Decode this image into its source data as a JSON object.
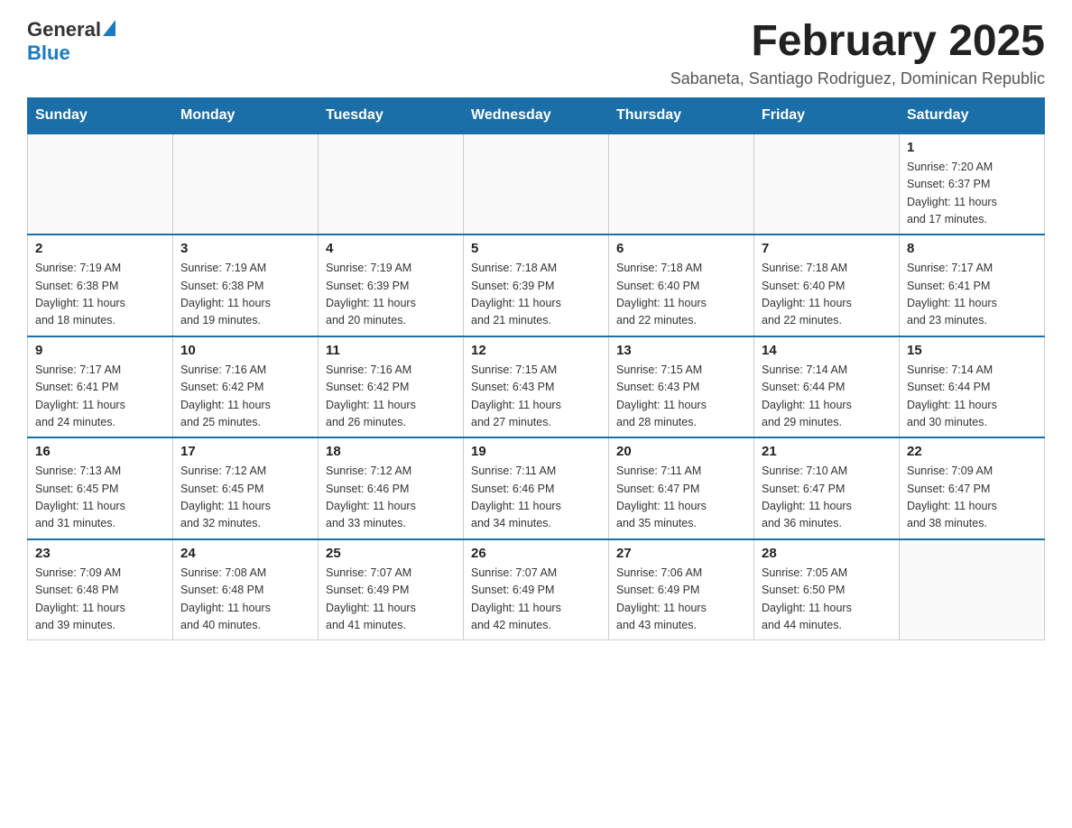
{
  "header": {
    "logo_general": "General",
    "logo_blue": "Blue",
    "main_title": "February 2025",
    "subtitle": "Sabaneta, Santiago Rodriguez, Dominican Republic"
  },
  "calendar": {
    "days_of_week": [
      "Sunday",
      "Monday",
      "Tuesday",
      "Wednesday",
      "Thursday",
      "Friday",
      "Saturday"
    ],
    "weeks": [
      [
        {
          "day": "",
          "info": ""
        },
        {
          "day": "",
          "info": ""
        },
        {
          "day": "",
          "info": ""
        },
        {
          "day": "",
          "info": ""
        },
        {
          "day": "",
          "info": ""
        },
        {
          "day": "",
          "info": ""
        },
        {
          "day": "1",
          "info": "Sunrise: 7:20 AM\nSunset: 6:37 PM\nDaylight: 11 hours\nand 17 minutes."
        }
      ],
      [
        {
          "day": "2",
          "info": "Sunrise: 7:19 AM\nSunset: 6:38 PM\nDaylight: 11 hours\nand 18 minutes."
        },
        {
          "day": "3",
          "info": "Sunrise: 7:19 AM\nSunset: 6:38 PM\nDaylight: 11 hours\nand 19 minutes."
        },
        {
          "day": "4",
          "info": "Sunrise: 7:19 AM\nSunset: 6:39 PM\nDaylight: 11 hours\nand 20 minutes."
        },
        {
          "day": "5",
          "info": "Sunrise: 7:18 AM\nSunset: 6:39 PM\nDaylight: 11 hours\nand 21 minutes."
        },
        {
          "day": "6",
          "info": "Sunrise: 7:18 AM\nSunset: 6:40 PM\nDaylight: 11 hours\nand 22 minutes."
        },
        {
          "day": "7",
          "info": "Sunrise: 7:18 AM\nSunset: 6:40 PM\nDaylight: 11 hours\nand 22 minutes."
        },
        {
          "day": "8",
          "info": "Sunrise: 7:17 AM\nSunset: 6:41 PM\nDaylight: 11 hours\nand 23 minutes."
        }
      ],
      [
        {
          "day": "9",
          "info": "Sunrise: 7:17 AM\nSunset: 6:41 PM\nDaylight: 11 hours\nand 24 minutes."
        },
        {
          "day": "10",
          "info": "Sunrise: 7:16 AM\nSunset: 6:42 PM\nDaylight: 11 hours\nand 25 minutes."
        },
        {
          "day": "11",
          "info": "Sunrise: 7:16 AM\nSunset: 6:42 PM\nDaylight: 11 hours\nand 26 minutes."
        },
        {
          "day": "12",
          "info": "Sunrise: 7:15 AM\nSunset: 6:43 PM\nDaylight: 11 hours\nand 27 minutes."
        },
        {
          "day": "13",
          "info": "Sunrise: 7:15 AM\nSunset: 6:43 PM\nDaylight: 11 hours\nand 28 minutes."
        },
        {
          "day": "14",
          "info": "Sunrise: 7:14 AM\nSunset: 6:44 PM\nDaylight: 11 hours\nand 29 minutes."
        },
        {
          "day": "15",
          "info": "Sunrise: 7:14 AM\nSunset: 6:44 PM\nDaylight: 11 hours\nand 30 minutes."
        }
      ],
      [
        {
          "day": "16",
          "info": "Sunrise: 7:13 AM\nSunset: 6:45 PM\nDaylight: 11 hours\nand 31 minutes."
        },
        {
          "day": "17",
          "info": "Sunrise: 7:12 AM\nSunset: 6:45 PM\nDaylight: 11 hours\nand 32 minutes."
        },
        {
          "day": "18",
          "info": "Sunrise: 7:12 AM\nSunset: 6:46 PM\nDaylight: 11 hours\nand 33 minutes."
        },
        {
          "day": "19",
          "info": "Sunrise: 7:11 AM\nSunset: 6:46 PM\nDaylight: 11 hours\nand 34 minutes."
        },
        {
          "day": "20",
          "info": "Sunrise: 7:11 AM\nSunset: 6:47 PM\nDaylight: 11 hours\nand 35 minutes."
        },
        {
          "day": "21",
          "info": "Sunrise: 7:10 AM\nSunset: 6:47 PM\nDaylight: 11 hours\nand 36 minutes."
        },
        {
          "day": "22",
          "info": "Sunrise: 7:09 AM\nSunset: 6:47 PM\nDaylight: 11 hours\nand 38 minutes."
        }
      ],
      [
        {
          "day": "23",
          "info": "Sunrise: 7:09 AM\nSunset: 6:48 PM\nDaylight: 11 hours\nand 39 minutes."
        },
        {
          "day": "24",
          "info": "Sunrise: 7:08 AM\nSunset: 6:48 PM\nDaylight: 11 hours\nand 40 minutes."
        },
        {
          "day": "25",
          "info": "Sunrise: 7:07 AM\nSunset: 6:49 PM\nDaylight: 11 hours\nand 41 minutes."
        },
        {
          "day": "26",
          "info": "Sunrise: 7:07 AM\nSunset: 6:49 PM\nDaylight: 11 hours\nand 42 minutes."
        },
        {
          "day": "27",
          "info": "Sunrise: 7:06 AM\nSunset: 6:49 PM\nDaylight: 11 hours\nand 43 minutes."
        },
        {
          "day": "28",
          "info": "Sunrise: 7:05 AM\nSunset: 6:50 PM\nDaylight: 11 hours\nand 44 minutes."
        },
        {
          "day": "",
          "info": ""
        }
      ]
    ]
  }
}
